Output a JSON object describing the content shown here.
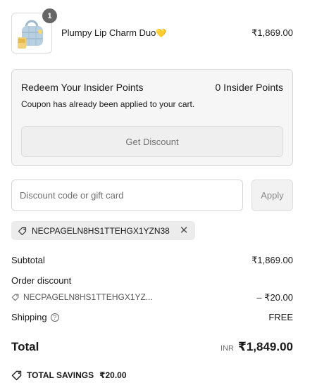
{
  "product": {
    "quantity": "1",
    "name": "Plumpy Lip Charm Duo",
    "name_emoji": "💛",
    "price": "₹1,869.00"
  },
  "insider": {
    "title": "Redeem Your Insider Points",
    "points": "0 Insider Points",
    "note": "Coupon has already been applied to your cart.",
    "button_label": "Get Discount"
  },
  "discount": {
    "placeholder": "Discount code or gift card",
    "apply_label": "Apply",
    "applied_code": "NECPAGELN8HS1TTEHGX1YZN38"
  },
  "summary": {
    "subtotal_label": "Subtotal",
    "subtotal_value": "₹1,869.00",
    "order_discount_label": "Order discount",
    "order_discount_code": "NECPAGELN8HS1TTEHGX1YZ...",
    "order_discount_value": "– ₹20.00",
    "shipping_label": "Shipping",
    "shipping_value": "FREE",
    "total_label": "Total",
    "currency": "INR",
    "total_value": "₹1,849.00",
    "savings_label": "TOTAL SAVINGS",
    "savings_value": "₹20.00"
  },
  "icons": {
    "tag": "tag-icon",
    "close": "close-icon",
    "help": "help-icon",
    "savings": "savings-tag-icon"
  }
}
